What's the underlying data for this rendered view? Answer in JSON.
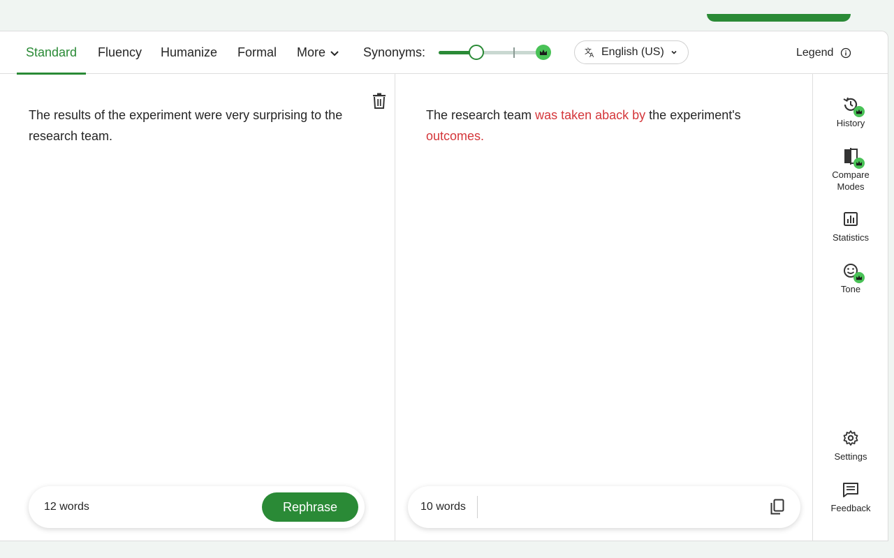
{
  "tabs": [
    {
      "label": "Standard",
      "active": true
    },
    {
      "label": "Fluency"
    },
    {
      "label": "Humanize"
    },
    {
      "label": "Formal"
    },
    {
      "label": "More"
    }
  ],
  "synonyms": {
    "label": "Synonyms:",
    "level_fraction": 0.33
  },
  "language": {
    "label": "English (US)"
  },
  "legend": {
    "label": "Legend"
  },
  "input": {
    "text": "The results of the experiment were very surprising to the research team.",
    "word_count": "12 words",
    "rephrase_label": "Rephrase"
  },
  "output": {
    "part1": "The research team ",
    "changed1": "was taken aback by",
    "part2": " the experiment's ",
    "changed2": "outcomes.",
    "word_count": "10 words"
  },
  "sidebar": {
    "history": "History",
    "compare_line1": "Compare",
    "compare_line2": "Modes",
    "statistics": "Statistics",
    "tone": "Tone",
    "settings": "Settings",
    "feedback": "Feedback"
  },
  "colors": {
    "accent": "#2a8a36",
    "premium": "#49c257",
    "changed_text": "#d4363a"
  }
}
